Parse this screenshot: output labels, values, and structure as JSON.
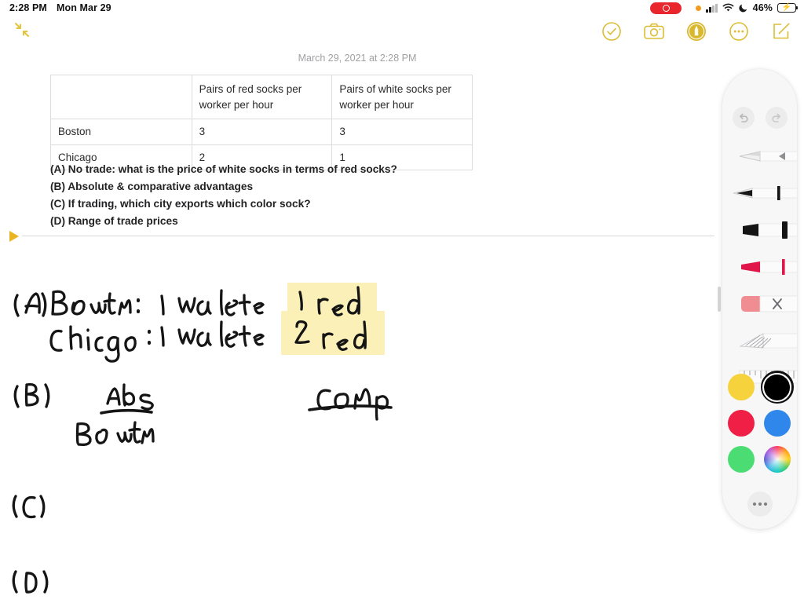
{
  "status_bar": {
    "time": "2:28 PM",
    "date": "Mon Mar 29",
    "battery_percent": "46%",
    "icons": [
      "screen-recording-pill",
      "orange-privacy-dot",
      "cellular-signal",
      "wifi",
      "do-not-disturb-moon",
      "battery-charging"
    ]
  },
  "toolbar": {
    "collapse_label": "collapse-arrows",
    "items": [
      {
        "name": "checklist-done-icon"
      },
      {
        "name": "camera-icon"
      },
      {
        "name": "apple-pencil-icon"
      },
      {
        "name": "more-options-icon"
      },
      {
        "name": "compose-icon"
      }
    ],
    "accent_color": "#d6b42a"
  },
  "document": {
    "date_stamp": "March 29, 2021 at 2:28 PM",
    "table": {
      "headers": [
        "",
        "Pairs of red socks per worker per hour",
        "Pairs of white socks per worker per hour"
      ],
      "rows": [
        [
          "Boston",
          "3",
          "3"
        ],
        [
          "Chicago",
          "2",
          "1"
        ]
      ]
    },
    "questions": [
      "(A) No trade: what is the price of white socks in terms of red socks?",
      "(B) Absolute & comparative advantages",
      "(C) If trading, which city exports which color sock?",
      "(D) Range of trade prices"
    ],
    "handwriting": {
      "line_a_label": "(A)",
      "line_a_boston": "Boston :",
      "line_a_boston_white": "1 white",
      "line_a_boston_red": "1 red",
      "line_a_chicago": "Chicago:",
      "line_a_chicago_white": "1 white",
      "line_a_chicago_red": "2 red",
      "line_b_label": "(B)",
      "line_b_abs": "Abs",
      "line_b_boston": "Boston",
      "line_b_comp": "Comp",
      "line_c_label": "(C)",
      "line_d_label": "(D)",
      "highlight_color": "#fbefb4",
      "ink_color": "#1a1a1a"
    }
  },
  "palette": {
    "undo_label": "undo",
    "redo_label": "redo",
    "tools": [
      {
        "name": "pencil-tool"
      },
      {
        "name": "pen-tool",
        "selected": true
      },
      {
        "name": "marker-tool",
        "size": "30"
      },
      {
        "name": "highlighter-tool",
        "size": "50"
      },
      {
        "name": "eraser-tool"
      },
      {
        "name": "lasso-tool"
      },
      {
        "name": "ruler-tool"
      }
    ],
    "colors": [
      {
        "name": "yellow",
        "hex": "#f6d33c",
        "selected": false
      },
      {
        "name": "black",
        "hex": "#000000",
        "selected": true
      },
      {
        "name": "red",
        "hex": "#ef1f45",
        "selected": false
      },
      {
        "name": "blue",
        "hex": "#2f86eb",
        "selected": false
      },
      {
        "name": "green",
        "hex": "#4cdc74",
        "selected": false
      },
      {
        "name": "color-wheel",
        "hex": "#ffffff",
        "selected": false
      }
    ],
    "more_label": "more-tool-options"
  }
}
